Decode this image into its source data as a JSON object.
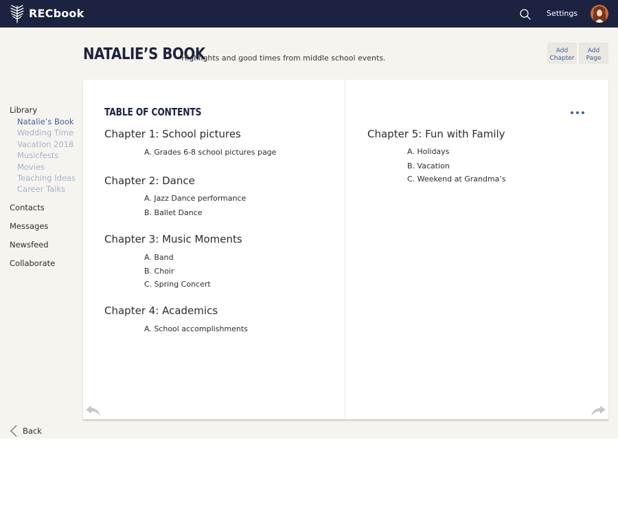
{
  "app": {
    "name": "RECbook"
  },
  "topbar": {
    "settings_label": "Settings"
  },
  "header": {
    "title": "NATALIE’S BOOK",
    "subtitle": "Highlights and good times from middle school events.",
    "add_chapter_label": [
      "Add",
      "Chapter"
    ],
    "add_page_label": [
      "Add",
      "Page"
    ]
  },
  "sidebar": {
    "library_label": "Library",
    "library_items": [
      "Natalie’s Book",
      "Wedding Time",
      "Vacation 2018",
      "Musicfests",
      "Movies",
      "Teaching Ideas",
      "Career Talks"
    ],
    "active_item": "Natalie’s Book",
    "nav_items": [
      "Contacts",
      "Messages",
      "Newsfeed",
      "Collaborate"
    ],
    "back_label": "Back"
  },
  "book": {
    "toc_heading": "TABLE OF CONTENTS",
    "chapters": [
      {
        "title": "Chapter 1: School pictures",
        "items": [
          "A. Grades 6-8 school pictures page"
        ]
      },
      {
        "title": "Chapter 2: Dance",
        "items": [
          "A. Jazz Dance performance",
          "B. Ballet Dance"
        ]
      },
      {
        "title": "Chapter 3: Music Moments",
        "items": [
          "A. Band",
          "B. Choir",
          "C. Spring Concert"
        ]
      },
      {
        "title": "Chapter 4: Academics",
        "items": [
          "A. School accomplishments"
        ]
      },
      {
        "title": "Chapter 5: Fun with Family",
        "items": [
          "A. Holidays",
          "B. Vacation",
          "C. Weekend at Grandma’s"
        ]
      }
    ]
  },
  "colors": {
    "topbar": "#1c2341",
    "accent": "#3f5d9a",
    "muted_link": "#a3b2cf",
    "background": "#f6f4ef"
  },
  "icons": {
    "logo": "palm-leaf-icon",
    "search": "search-icon",
    "more": "more-dots-icon",
    "prev": "curved-arrow-left-icon",
    "next": "curved-arrow-right-icon",
    "back": "chevron-left-icon"
  }
}
